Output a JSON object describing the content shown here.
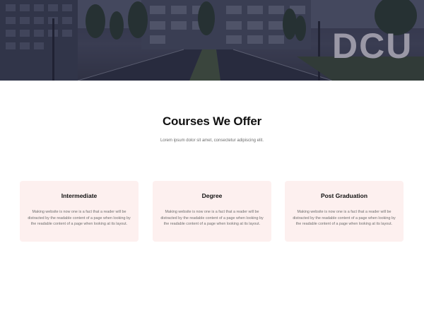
{
  "hero": {
    "sign_text": "DCU"
  },
  "section": {
    "title": "Courses We Offer",
    "subtitle": "Lorem ipsum dolor sit amet, consectetur adipiscing elit."
  },
  "courses": [
    {
      "title": "Intermediate",
      "description": "Making website is now one is a fact that a reader will be distracted by the readable content of a page when looking by the readable content of a page when looking at its layout."
    },
    {
      "title": "Degree",
      "description": "Making website is now one is a fact that a reader will be distracted by the readable content of a page when looking by the readable content of a page when looking at its layout."
    },
    {
      "title": "Post Graduation",
      "description": "Making website is now one is a fact that a reader will be distracted by the readable content of a page when looking by the readable content of a page when looking at its layout."
    }
  ],
  "colors": {
    "card_background": "#fdf0ef",
    "title_text": "#111111",
    "body_text": "#6f6f6f"
  }
}
